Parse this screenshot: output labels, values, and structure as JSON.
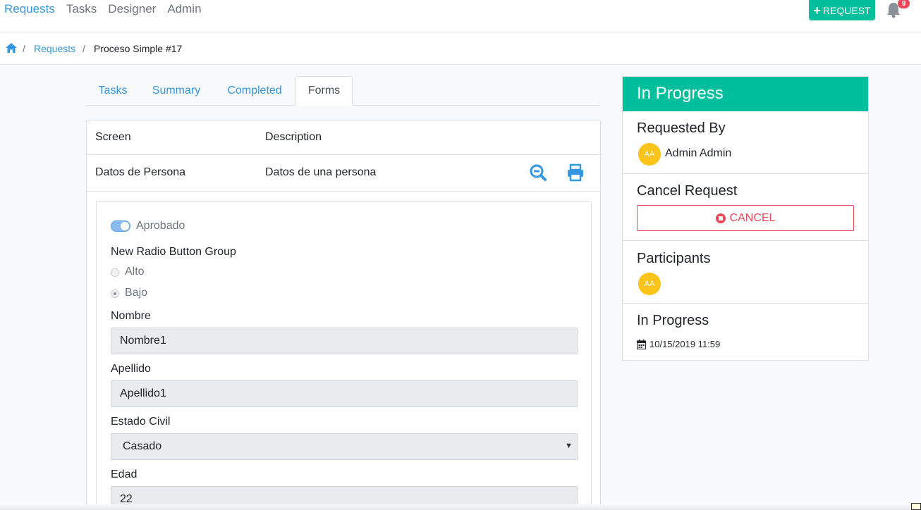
{
  "nav": {
    "links": [
      "Requests",
      "Tasks",
      "Designer",
      "Admin"
    ],
    "request_button": "REQUEST",
    "notification_count": "9"
  },
  "breadcrumb": {
    "link": "Requests",
    "current": "Proceso Simple #17",
    "separator": "/"
  },
  "tabs": [
    "Tasks",
    "Summary",
    "Completed",
    "Forms"
  ],
  "table": {
    "headers": [
      "Screen",
      "Description"
    ],
    "rows": [
      {
        "screen": "Datos de Persona",
        "description": "Datos de una persona"
      }
    ]
  },
  "form": {
    "toggle_label": "Aprobado",
    "radio_group_label": "New Radio Button Group",
    "radio_options": [
      "Alto",
      "Bajo"
    ],
    "selected_radio": "Bajo",
    "nombre_label": "Nombre",
    "nombre_value": "Nombre1",
    "apellido_label": "Apellido",
    "apellido_value": "Apellido1",
    "estado_label": "Estado Civil",
    "estado_value": "Casado",
    "edad_label": "Edad",
    "edad_value": "22"
  },
  "sidebar": {
    "header": "In Progress",
    "requested_by_title": "Requested By",
    "requester_initials": "AA",
    "requester_name": "Admin Admin",
    "cancel_title": "Cancel Request",
    "cancel_button": "CANCEL",
    "participants_title": "Participants",
    "participant_initials": "AA",
    "status_title": "In Progress",
    "status_date": "10/15/2019 11:59"
  },
  "colors": {
    "primary": "#3397e1",
    "success": "#00bf9c",
    "danger": "#ed4757",
    "avatar": "#fcc419"
  }
}
